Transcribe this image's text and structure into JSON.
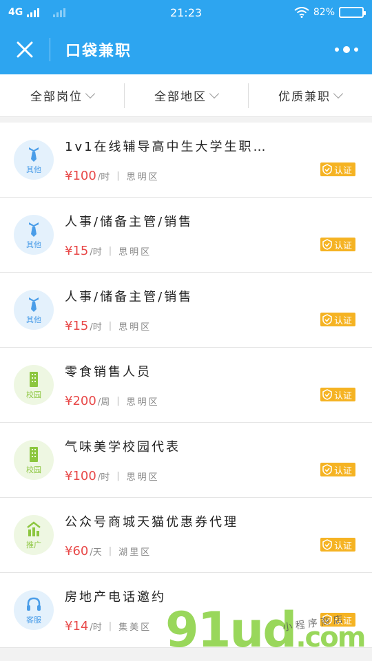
{
  "status": {
    "network": "4G",
    "time": "21:23",
    "battery": "82%",
    "battery_fill": 0.82
  },
  "nav": {
    "title": "口袋兼职"
  },
  "filters": [
    {
      "label": "全部岗位"
    },
    {
      "label": "全部地区"
    },
    {
      "label": "优质兼职"
    }
  ],
  "jobs": [
    {
      "title": "1v1在线辅导高中生大学生职…",
      "price": "¥100",
      "unit": "/时",
      "district": "思明区",
      "category": "其他",
      "icon": "tie-icon",
      "cert": "认证"
    },
    {
      "title": "人事/储备主管/销售",
      "price": "¥15",
      "unit": "/时",
      "district": "思明区",
      "category": "其他",
      "icon": "tie-icon",
      "cert": "认证"
    },
    {
      "title": "人事/储备主管/销售",
      "price": "¥15",
      "unit": "/时",
      "district": "思明区",
      "category": "其他",
      "icon": "tie-icon",
      "cert": "认证"
    },
    {
      "title": "零食销售人员",
      "price": "¥200",
      "unit": "/周",
      "district": "思明区",
      "category": "校园",
      "icon": "building-icon",
      "cert": "认证"
    },
    {
      "title": "气味美学校园代表",
      "price": "¥100",
      "unit": "/时",
      "district": "思明区",
      "category": "校园",
      "icon": "building-icon",
      "cert": "认证"
    },
    {
      "title": "公众号商城天猫优惠券代理",
      "price": "¥60",
      "unit": "/天",
      "district": "湖里区",
      "category": "推广",
      "icon": "chart-icon",
      "cert": "认证"
    },
    {
      "title": "房地产电话邀约",
      "price": "¥14",
      "unit": "/时",
      "district": "集美区",
      "category": "客服",
      "icon": "headset-icon",
      "cert": "认证"
    }
  ],
  "watermark": {
    "brand": "91ud",
    "suffix": ".com",
    "sub": "小 程 序 商 店"
  },
  "colors": {
    "primary": "#2da5f0",
    "price": "#e84a4a",
    "cert": "#f5b323",
    "blue_tag": "#4a9de8",
    "green_tag": "#8cc63f"
  }
}
